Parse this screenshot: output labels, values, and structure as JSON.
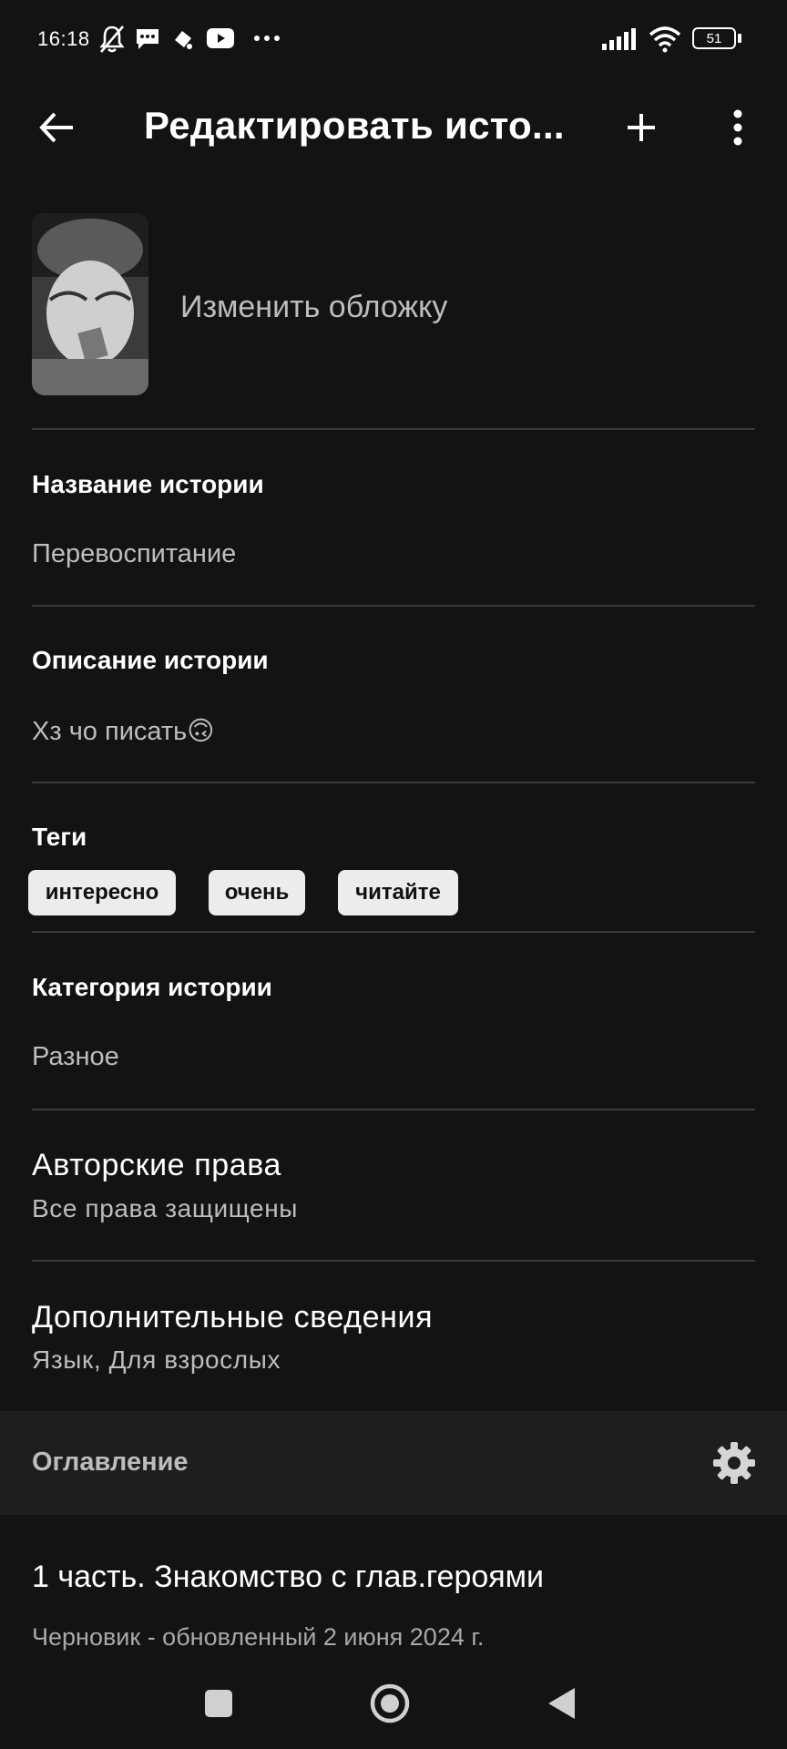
{
  "status_bar": {
    "time": "16:18",
    "battery": "51",
    "icons": [
      "notifications-off-icon",
      "message-icon",
      "app-icon",
      "youtube-icon",
      "more-dots-icon",
      "signal-icon",
      "wifi-icon",
      "battery-icon"
    ]
  },
  "app_bar": {
    "title": "Редактировать исто...",
    "icons": [
      "back-arrow-icon",
      "plus-icon",
      "more-vertical-icon"
    ]
  },
  "cover": {
    "change_label": "Изменить обложку"
  },
  "story_title": {
    "label": "Название истории",
    "value": "Перевоспитание"
  },
  "description": {
    "label": "Описание истории",
    "value": "Хз чо писать🙃"
  },
  "tags": {
    "label": "Теги",
    "items": [
      "интересно",
      "очень",
      "читайте"
    ]
  },
  "category": {
    "label": "Категория истории",
    "value": "Разное"
  },
  "copyright": {
    "label": "Авторские права",
    "value": "Все права защищены"
  },
  "extra_info": {
    "label": "Дополнительные сведения",
    "value": "Язык, Для взрослых"
  },
  "toc": {
    "label": "Оглавление",
    "icon": "gear-icon"
  },
  "chapter": {
    "title": "1 часть. Знакомство с глав.героями",
    "subtitle": "Черновик - обновленный 2 июня 2024 г."
  },
  "nav_bar": {
    "icons": [
      "recents-square-icon",
      "home-circle-icon",
      "back-triangle-icon"
    ]
  }
}
